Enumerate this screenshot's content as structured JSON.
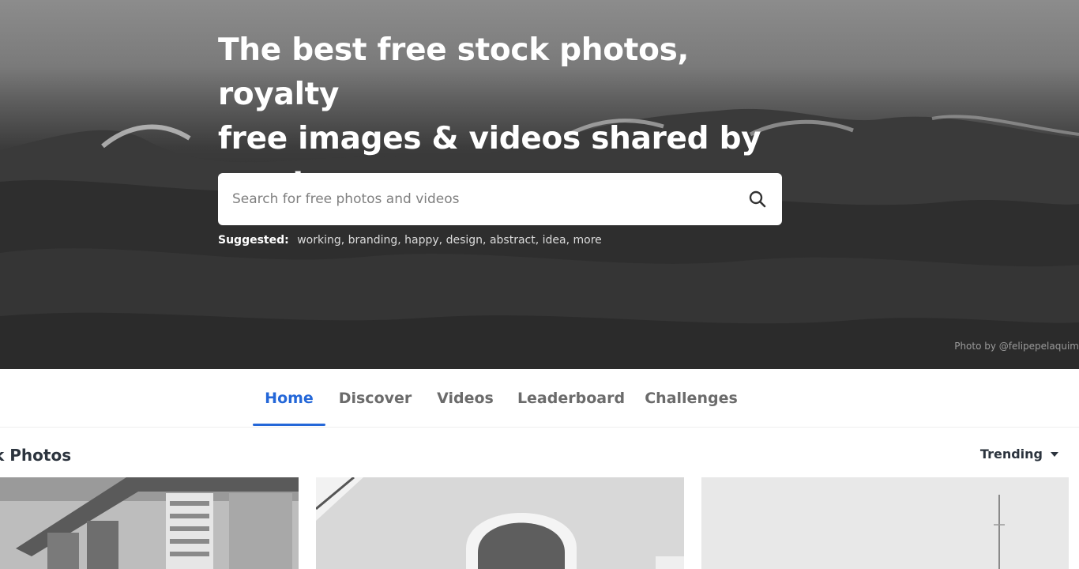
{
  "hero": {
    "title_line1": "The best free stock photos, royalty",
    "title_line2": "free images & videos shared by",
    "title_line3": "creators.",
    "photo_credit": "Photo by @felipepelaquim"
  },
  "search": {
    "placeholder": "Search for free photos and videos",
    "value": "",
    "icon": "search-icon"
  },
  "suggested": {
    "label": "Suggested:",
    "tags": [
      "working,",
      "branding,",
      "happy,",
      "design,",
      "abstract,",
      "idea,",
      "more"
    ]
  },
  "nav": {
    "tabs": [
      {
        "label": "Home",
        "active": true
      },
      {
        "label": "Discover",
        "active": false
      },
      {
        "label": "Videos",
        "active": false
      },
      {
        "label": "Leaderboard",
        "active": false
      },
      {
        "label": "Challenges",
        "active": false
      }
    ]
  },
  "section": {
    "title": "k Photos",
    "sort_label": "Trending",
    "sort_icon": "caret-down-icon"
  },
  "colors": {
    "accent": "#2467d8",
    "text": "#2c343e",
    "muted": "#6b6b6b"
  }
}
